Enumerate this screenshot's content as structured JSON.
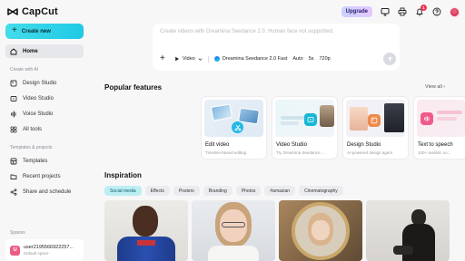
{
  "topbar": {
    "logo_text": "CapCut",
    "upgrade_label": "Upgrade",
    "notification_count": "1",
    "icons": [
      "monitor-icon",
      "print-icon",
      "bell-icon",
      "help-icon"
    ]
  },
  "sidebar": {
    "create_label": "Create new",
    "home_label": "Home",
    "ai_section": "Create with AI",
    "ai_items": [
      "Design Studio",
      "Video Studio",
      "Voice Studio",
      "All tools"
    ],
    "projects_section": "Templates & projects",
    "project_items": [
      "Templates",
      "Recent projects",
      "Share and schedule"
    ],
    "spaces_section": "Spaces",
    "space": {
      "avatar": "U",
      "name": "user2195566922257...",
      "sub": "Default space"
    }
  },
  "prompt": {
    "placeholder": "Create videos with Dreamina Seedance 2.0. Human face not supported.",
    "mode": "Video",
    "model": "Dreamina Seedance 2.0 Fast",
    "ratio": "Auto",
    "duration": "5s",
    "resolution": "720p"
  },
  "popular": {
    "title": "Popular features",
    "view_all": "View all",
    "cards": [
      {
        "title": "Edit video",
        "sub": "Timeline-based editing"
      },
      {
        "title": "Video Studio",
        "sub": "Try Dreamina Seedance ..."
      },
      {
        "title": "Design Studio",
        "sub": "AI-powered design agent"
      },
      {
        "title": "Text to speech",
        "sub": "100+ realistic vo..."
      }
    ]
  },
  "inspiration": {
    "title": "Inspiration",
    "chips": [
      "Social media",
      "Effects",
      "Posters",
      "Branding",
      "Photos",
      "#amazian",
      "Cinematography"
    ]
  },
  "colors": {
    "accent": "#22cbe6",
    "active_chip": "#bdeef3",
    "badge": "#f2334f"
  }
}
